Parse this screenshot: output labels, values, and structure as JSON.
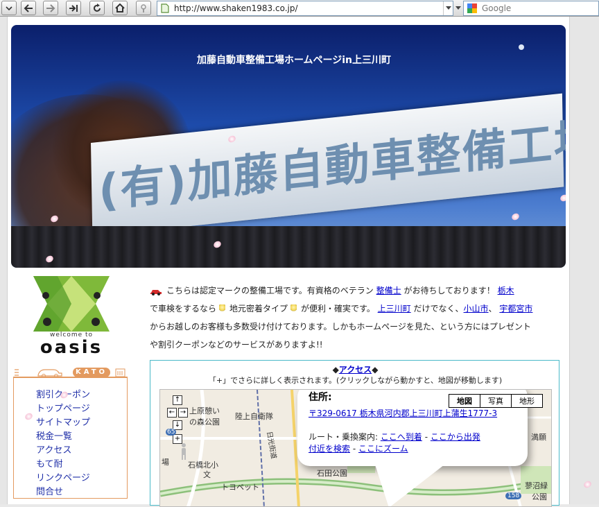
{
  "browser": {
    "url": "http://www.shaken1983.co.jp/",
    "search_placeholder": "Google"
  },
  "banner": {
    "title": "加藤自動車整備工場ホームページin上三川町",
    "sign_text": "(有)加藤自動車整備工場"
  },
  "logo": {
    "welcome": "welcome to",
    "name": "oasis"
  },
  "intro": {
    "t1": "こちらは認定マークの整備工場です。有資格のベテラン",
    "l1": "整備士",
    "t2": "がお待ちしております！",
    "l2": "栃木",
    "t3": "で車検をするなら",
    "t4": "地元密着タイプ",
    "t5": "が便利・確実です。",
    "l3": "上三川町",
    "t6": "だけでなく、",
    "l4": "小山市",
    "t7": "、",
    "l5": "宇都宮市",
    "t8": "からお越しのお客様も多数受け付けております。しかもホームページを見た、という方にはプレゼント",
    "t9": "や割引クーポンなどのサービスがありますよ!!"
  },
  "nav": {
    "header_badge": "KATO",
    "items": [
      {
        "label": "割引クーポン"
      },
      {
        "label": "トップページ"
      },
      {
        "label": "サイトマップ"
      },
      {
        "label": "税金一覧"
      },
      {
        "label": "アクセス"
      },
      {
        "label": "もて耐"
      },
      {
        "label": "リンクページ"
      },
      {
        "label": "問合せ"
      }
    ]
  },
  "map": {
    "title_prefix": "◆",
    "title_link": "アクセス",
    "title_suffix": "◆",
    "subtitle": "「+」でさらに詳しく表示されます。(クリックしながら動かすと、地図が移動します)",
    "types": [
      {
        "label": "地図"
      },
      {
        "label": "写真"
      },
      {
        "label": "地形"
      }
    ],
    "labels": {
      "l1": "上原憩い",
      "l2": "の森公園",
      "l3": "陸上自衛隊",
      "l4": "石橋北小",
      "l5": "文",
      "l6": "日光街道",
      "l7": "トヨペット",
      "l8": "石田公園",
      "l9": "場",
      "l10": "満願",
      "l11": "蓼沼緑",
      "l12": "公園",
      "l13": "158",
      "l14": "65"
    },
    "bubble": {
      "address_heading": "住所:",
      "address": "〒329-0617 栃木県河内郡上三川町上蒲生1777-3",
      "route_label": "ルート・乗換案内:",
      "route_to": "ここへ到着",
      "route_from": "ここから出発",
      "search_near": "付近を検索",
      "zoom_here": "ここにズーム"
    }
  },
  "colors": {
    "link": "#0000cc",
    "nav_border": "#e39a5f",
    "nav_text": "#1f2fa8",
    "map_border": "#49b9c8"
  }
}
